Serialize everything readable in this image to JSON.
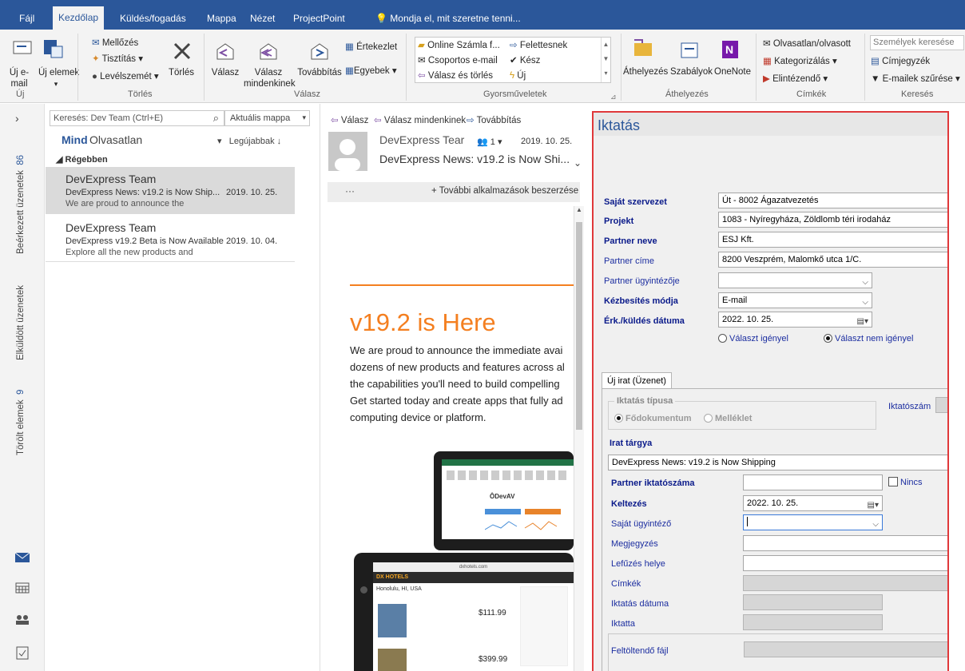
{
  "tabs": [
    "Fájl",
    "Kezdőlap",
    "Küldés/fogadás",
    "Mappa",
    "Nézet",
    "ProjectPoint",
    "Mondja el, mit szeretne tenni..."
  ],
  "ribbon": {
    "new_email": [
      "Új e-",
      "mail"
    ],
    "new_items": [
      "Új elemek"
    ],
    "ignore": "Mellőzés",
    "cleanup": "Tisztítás",
    "junk": "Levélszemét",
    "delete": "Törlés",
    "reply": "Válasz",
    "reply_all": [
      "Válasz",
      "mindenkinek"
    ],
    "forward": "Továbbítás",
    "meeting": "Értekezlet",
    "more": "Egyebek",
    "qs1": "Online Számla f...",
    "qs2": "Felettesnek",
    "qs3": "Csoportos e-mail",
    "qs4": "Kész",
    "qs5": "Válasz és törlés",
    "qs6": "Új",
    "move": "Áthelyezés",
    "rules": "Szabályok",
    "onenote": "OneNote",
    "unread_read": "Olvasatlan/olvasott",
    "categorize": "Kategorizálás",
    "followup": "Elintézendő",
    "search_people": "Személyek keresése",
    "address_book": "Címjegyzék",
    "filter_email": "E-mailek szűrése",
    "groups": [
      "Új",
      "Törlés",
      "Válasz",
      "Gyorsműveletek",
      "Áthelyezés",
      "Címkék",
      "Keresés"
    ]
  },
  "nav": {
    "folders": [
      "Beérkezett üzenetek",
      "Elküldött üzenetek",
      "Törölt elemek"
    ],
    "inbox_count": "86",
    "deleted_count": "9"
  },
  "list": {
    "search_placeholder": "Keresés: Dev Team (Ctrl+E)",
    "scope": "Aktuális mappa",
    "filter_all": "Mind",
    "filter_unread": "Olvasatlan",
    "sort": "Legújabbak",
    "group": "Régebben",
    "messages": [
      {
        "sender": "DevExpress Team",
        "subject": "DevExpress News: v19.2 is Now Ship...",
        "date": "2019. 10. 25.",
        "preview": "We are proud to announce the"
      },
      {
        "sender": "DevExpress Team",
        "subject": "DevExpress v19.2 Beta is Now Available",
        "date": "2019. 10. 04.",
        "preview": "Explore all the new products and"
      }
    ]
  },
  "reading": {
    "reply": "Válasz",
    "reply_all": "Válasz mindenkinek",
    "forward": "Továbbítás",
    "sender": "DevExpress Tear",
    "people_count": "1",
    "date": "2019. 10. 25.",
    "subject": "DevExpress News: v19.2 is Now Shi...",
    "ellipsis": "···",
    "get_addins": "További alkalmazások beszerzése",
    "headline": "v19.2 is Here",
    "body": [
      "We are proud to announce the immediate avai",
      "dozens of new products and features across al",
      "the capabilities you'll need to build compelling",
      "Get started today and create apps that fully ad",
      "computing device or platform."
    ],
    "ad": {
      "brand": "DX HOTELS",
      "city": "Honolulu, HI, USA",
      "price1": "$111.99",
      "price2": "$399.99",
      "url": "dxhotels.com"
    }
  },
  "dialog": {
    "title": "Iktatás",
    "labels": {
      "own_org": "Saját szervezet",
      "project": "Projekt",
      "partner_name": "Partner neve",
      "partner_addr": "Partner címe",
      "partner_admin": "Partner ügyintézője",
      "delivery": "Kézbesítés módja",
      "date_label": "Érk./küldés dátuma",
      "radio_need": "Választ igényel",
      "radio_noneed": "Választ nem igényel",
      "tab": "Új irat (Üzenet)",
      "type_group": "Iktatás típusa",
      "main_doc": "Fődokumentum",
      "attachment": "Melléklet",
      "reg_no": "Iktatószám",
      "subject_label": "Irat tárgya",
      "partner_regno": "Partner iktatószáma",
      "none": "Nincs",
      "dated": "Keltezés",
      "own_admin": "Saját ügyintéző",
      "note": "Megjegyzés",
      "filing": "Lefűzés helye",
      "tags": "Címkék",
      "reg_date": "Iktatás dátuma",
      "registered_by": "Iktatta",
      "upload": "Feltöltendő fájl"
    },
    "values": {
      "own_org": "Út - 8002 Ágazatvezetés",
      "project": "1083 - Nyíregyháza, Zöldlomb téri irodaház",
      "partner_name": "ESJ Kft.",
      "partner_addr": "8200 Veszprém, Malomkő utca 1/C.",
      "delivery": "E-mail",
      "date": "2022. 10. 25.",
      "subject": "DevExpress News: v19.2 is Now Shipping",
      "dated": "2022. 10. 25."
    },
    "response_required": false
  }
}
